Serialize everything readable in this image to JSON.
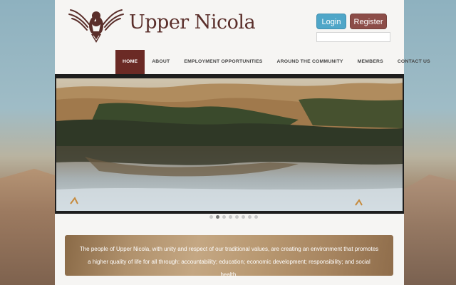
{
  "brand": {
    "name": "Upper Nicola",
    "logo_icon": "eagle-logo-icon"
  },
  "auth": {
    "login_label": "Login",
    "register_label": "Register",
    "search_value": ""
  },
  "nav": {
    "items": [
      {
        "label": "HOME",
        "active": true
      },
      {
        "label": "ABOUT"
      },
      {
        "label": "EMPLOYMENT OPPORTUNITIES"
      },
      {
        "label": "AROUND THE COMMUNITY"
      },
      {
        "label": "MEMBERS"
      },
      {
        "label": "CONTACT US"
      }
    ]
  },
  "slider": {
    "dot_count": 8,
    "active_dot": 2
  },
  "mission": {
    "text": "The people of Upper Nicola, with unity and respect of our traditional values, are creating an environment that promotes a higher quality of life for all through: accountability; education; economic development; responsibility; and social health."
  },
  "colors": {
    "accent": "#6b2a25",
    "login": "#4fa6c8",
    "register": "#8c4d48"
  }
}
